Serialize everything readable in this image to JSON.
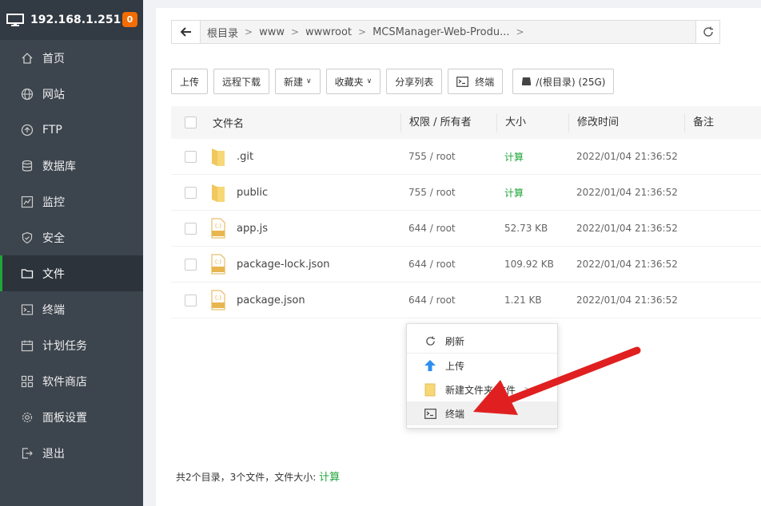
{
  "header": {
    "ip": "192.168.1.251",
    "badge": "0"
  },
  "menu": [
    {
      "label": "首页",
      "icon": "home-icon"
    },
    {
      "label": "网站",
      "icon": "globe-icon"
    },
    {
      "label": "FTP",
      "icon": "ftp-icon"
    },
    {
      "label": "数据库",
      "icon": "database-icon"
    },
    {
      "label": "监控",
      "icon": "monitor-chart-icon"
    },
    {
      "label": "安全",
      "icon": "shield-icon"
    },
    {
      "label": "文件",
      "icon": "folder-icon"
    },
    {
      "label": "终端",
      "icon": "terminal-icon"
    },
    {
      "label": "计划任务",
      "icon": "calendar-icon"
    },
    {
      "label": "软件商店",
      "icon": "grid-icon"
    },
    {
      "label": "面板设置",
      "icon": "gear-icon"
    },
    {
      "label": "退出",
      "icon": "logout-icon"
    }
  ],
  "breadcrumb": [
    "根目录",
    "www",
    "wwwroot",
    "MCSManager-Web-Produ..."
  ],
  "actions": {
    "upload": "上传",
    "remote_download": "远程下载",
    "new": "新建",
    "favorites": "收藏夹",
    "share_list": "分享列表",
    "terminal": "终端",
    "disk": "/(根目录) (25G)"
  },
  "table": {
    "headers": {
      "name": "文件名",
      "perm": "权限 / 所有者",
      "size": "大小",
      "mtime": "修改时间",
      "note": "备注"
    },
    "rows": [
      {
        "name": ".git",
        "perm": "755 / root",
        "size": "计算",
        "mtime": "2022/01/04 21:36:52"
      },
      {
        "name": "public",
        "perm": "755 / root",
        "size": "计算",
        "mtime": "2022/01/04 21:36:52"
      },
      {
        "name": "app.js",
        "perm": "644 / root",
        "size": "52.73 KB",
        "mtime": "2022/01/04 21:36:52"
      },
      {
        "name": "package-lock.json",
        "perm": "644 / root",
        "size": "109.92 KB",
        "mtime": "2022/01/04 21:36:52"
      },
      {
        "name": "package.json",
        "perm": "644 / root",
        "size": "1.21 KB",
        "mtime": "2022/01/04 21:36:52"
      }
    ]
  },
  "footer": {
    "summary": "共2个目录，3个文件，文件大小:",
    "calc": "计算"
  },
  "context_menu": {
    "refresh": "刷新",
    "upload": "上传",
    "new_folder_file": "新建文件夹/文件",
    "terminal": "终端"
  },
  "colors": {
    "sidebar": "#3c444d",
    "accent": "#20a53a",
    "badge": "#f56c00",
    "arrow": "#e02020"
  }
}
